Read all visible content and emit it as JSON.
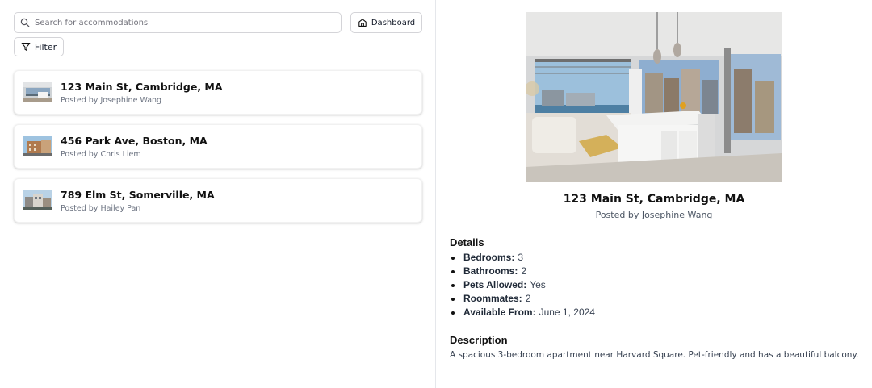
{
  "search": {
    "placeholder": "Search for accommodations",
    "value": ""
  },
  "toolbar": {
    "dashboard_label": "Dashboard",
    "filter_label": "Filter"
  },
  "listings": [
    {
      "title": "123 Main St, Cambridge, MA",
      "posted_by": "Posted by Josephine Wang"
    },
    {
      "title": "456 Park Ave, Boston, MA",
      "posted_by": "Posted by Chris Liem"
    },
    {
      "title": "789 Elm St, Somerville, MA",
      "posted_by": "Posted by Hailey Pan"
    }
  ],
  "detail": {
    "title": "123 Main St, Cambridge, MA",
    "posted_by": "Posted by Josephine Wang",
    "details_heading": "Details",
    "details": [
      {
        "label": "Bedrooms:",
        "value": "3"
      },
      {
        "label": "Bathrooms:",
        "value": "2"
      },
      {
        "label": "Pets Allowed:",
        "value": "Yes"
      },
      {
        "label": "Roommates:",
        "value": "2"
      },
      {
        "label": "Available From:",
        "value": "June 1, 2024"
      }
    ],
    "description_heading": "Description",
    "description": "A spacious 3-bedroom apartment near Harvard Square. Pet-friendly and has a beautiful balcony."
  },
  "icons": {
    "search": "search-icon",
    "dashboard": "home-icon",
    "filter": "filter-icon"
  }
}
